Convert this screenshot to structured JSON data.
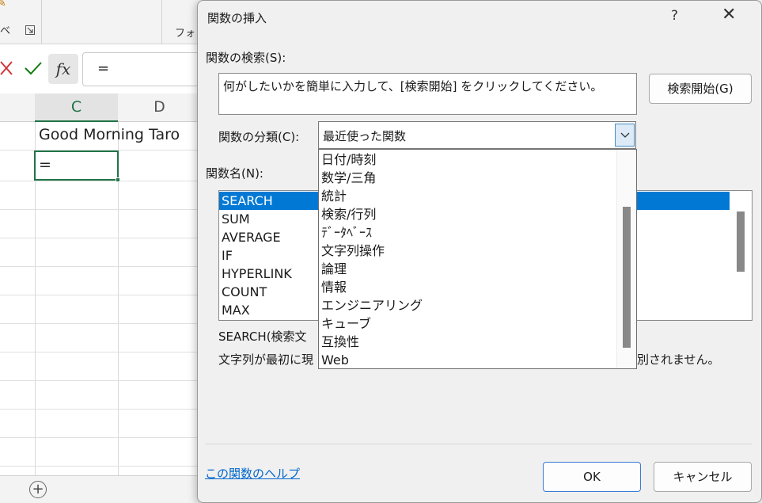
{
  "excel": {
    "ribbon_labels": [
      "ベ",
      "フォン"
    ],
    "formula_value": "=",
    "fx_label": "fx",
    "columns": [
      "C",
      "D"
    ],
    "cell_c1": "Good Morning Taro",
    "cell_c2": "=",
    "add_sheet": "+"
  },
  "dialog": {
    "title": "関数の挿入",
    "help_symbol": "?",
    "close_symbol": "✕",
    "search_label": "関数の検索(S):",
    "search_value": "何がしたいかを簡単に入力して、[検索開始] をクリックしてください。",
    "search_button": "検索開始(G)",
    "category_label": "関数の分類(C):",
    "category_value": "最近使った関数",
    "function_name_label": "関数名(N):",
    "functions": [
      "SEARCH",
      "SUM",
      "AVERAGE",
      "IF",
      "HYPERLINK",
      "COUNT",
      "MAX"
    ],
    "selected_function": "SEARCH",
    "syntax": "SEARCH(検索文",
    "description": "文字列が最初に現",
    "description_tail": "別されません。",
    "help_link": "この関数のヘルプ",
    "ok_button": "OK",
    "cancel_button": "キャンセル"
  },
  "category_dropdown": {
    "options": [
      "日付/時刻",
      "数学/三角",
      "統計",
      "検索/行列",
      "ﾃﾞｰﾀﾍﾞｰｽ",
      "文字列操作",
      "論理",
      "情報",
      "エンジニアリング",
      "キューブ",
      "互換性",
      "Web"
    ]
  },
  "colors": {
    "selection": "#0078d4",
    "excel_green": "#217346",
    "link": "#0066cc"
  }
}
